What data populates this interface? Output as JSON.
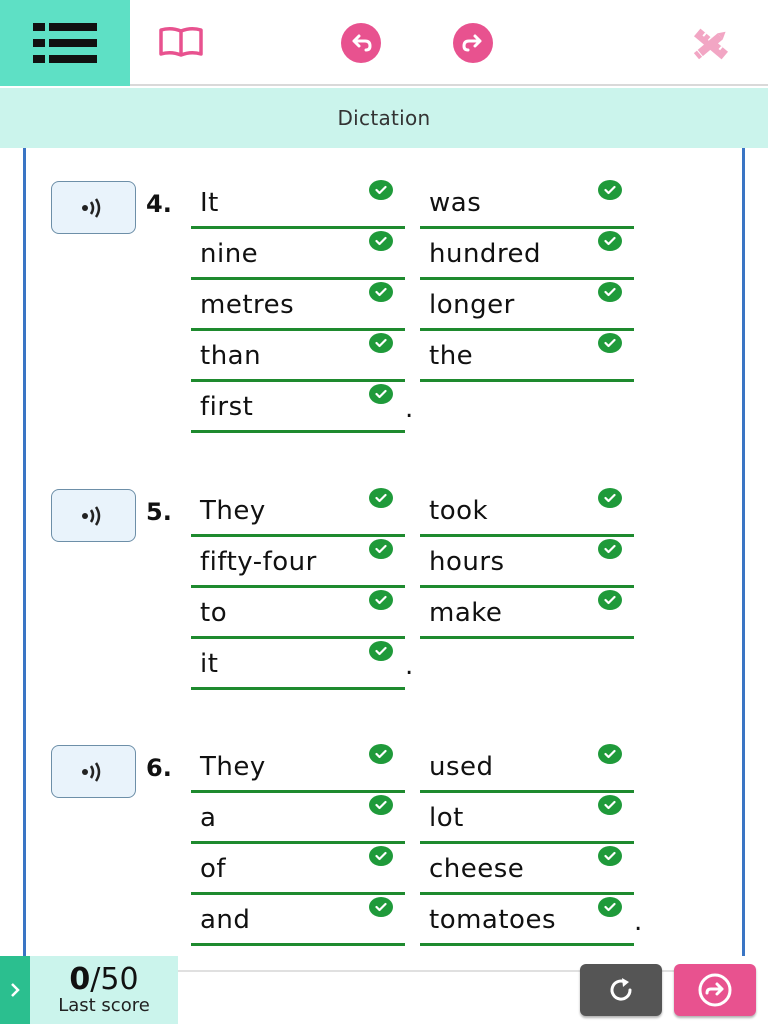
{
  "toolbar": {
    "menu_icon": "list-menu-icon",
    "book_icon": "book-icon",
    "undo_icon": "undo-icon",
    "redo_icon": "redo-icon",
    "tools_icon": "pencil-ruler-icon",
    "accent": "#5ee0c5",
    "pink": "#e8528f"
  },
  "title": "Dictation",
  "questions": [
    {
      "number": "4.",
      "words": [
        "It",
        "was",
        "nine",
        "hundred",
        "metres",
        "longer",
        "than",
        "the",
        "first"
      ],
      "ending": "."
    },
    {
      "number": "5.",
      "words": [
        "They",
        "took",
        "fifty-four",
        "hours",
        "to",
        "make",
        "it"
      ],
      "ending": "."
    },
    {
      "number": "6.",
      "words": [
        "They",
        "used",
        "a",
        "lot",
        "of",
        "cheese",
        "and",
        "tomatoes"
      ],
      "ending": "."
    }
  ],
  "footer": {
    "score_value": "0",
    "score_total": "/50",
    "score_label": "Last score",
    "retry_icon": "retry-icon",
    "submit_icon": "submit-arrow-icon"
  }
}
